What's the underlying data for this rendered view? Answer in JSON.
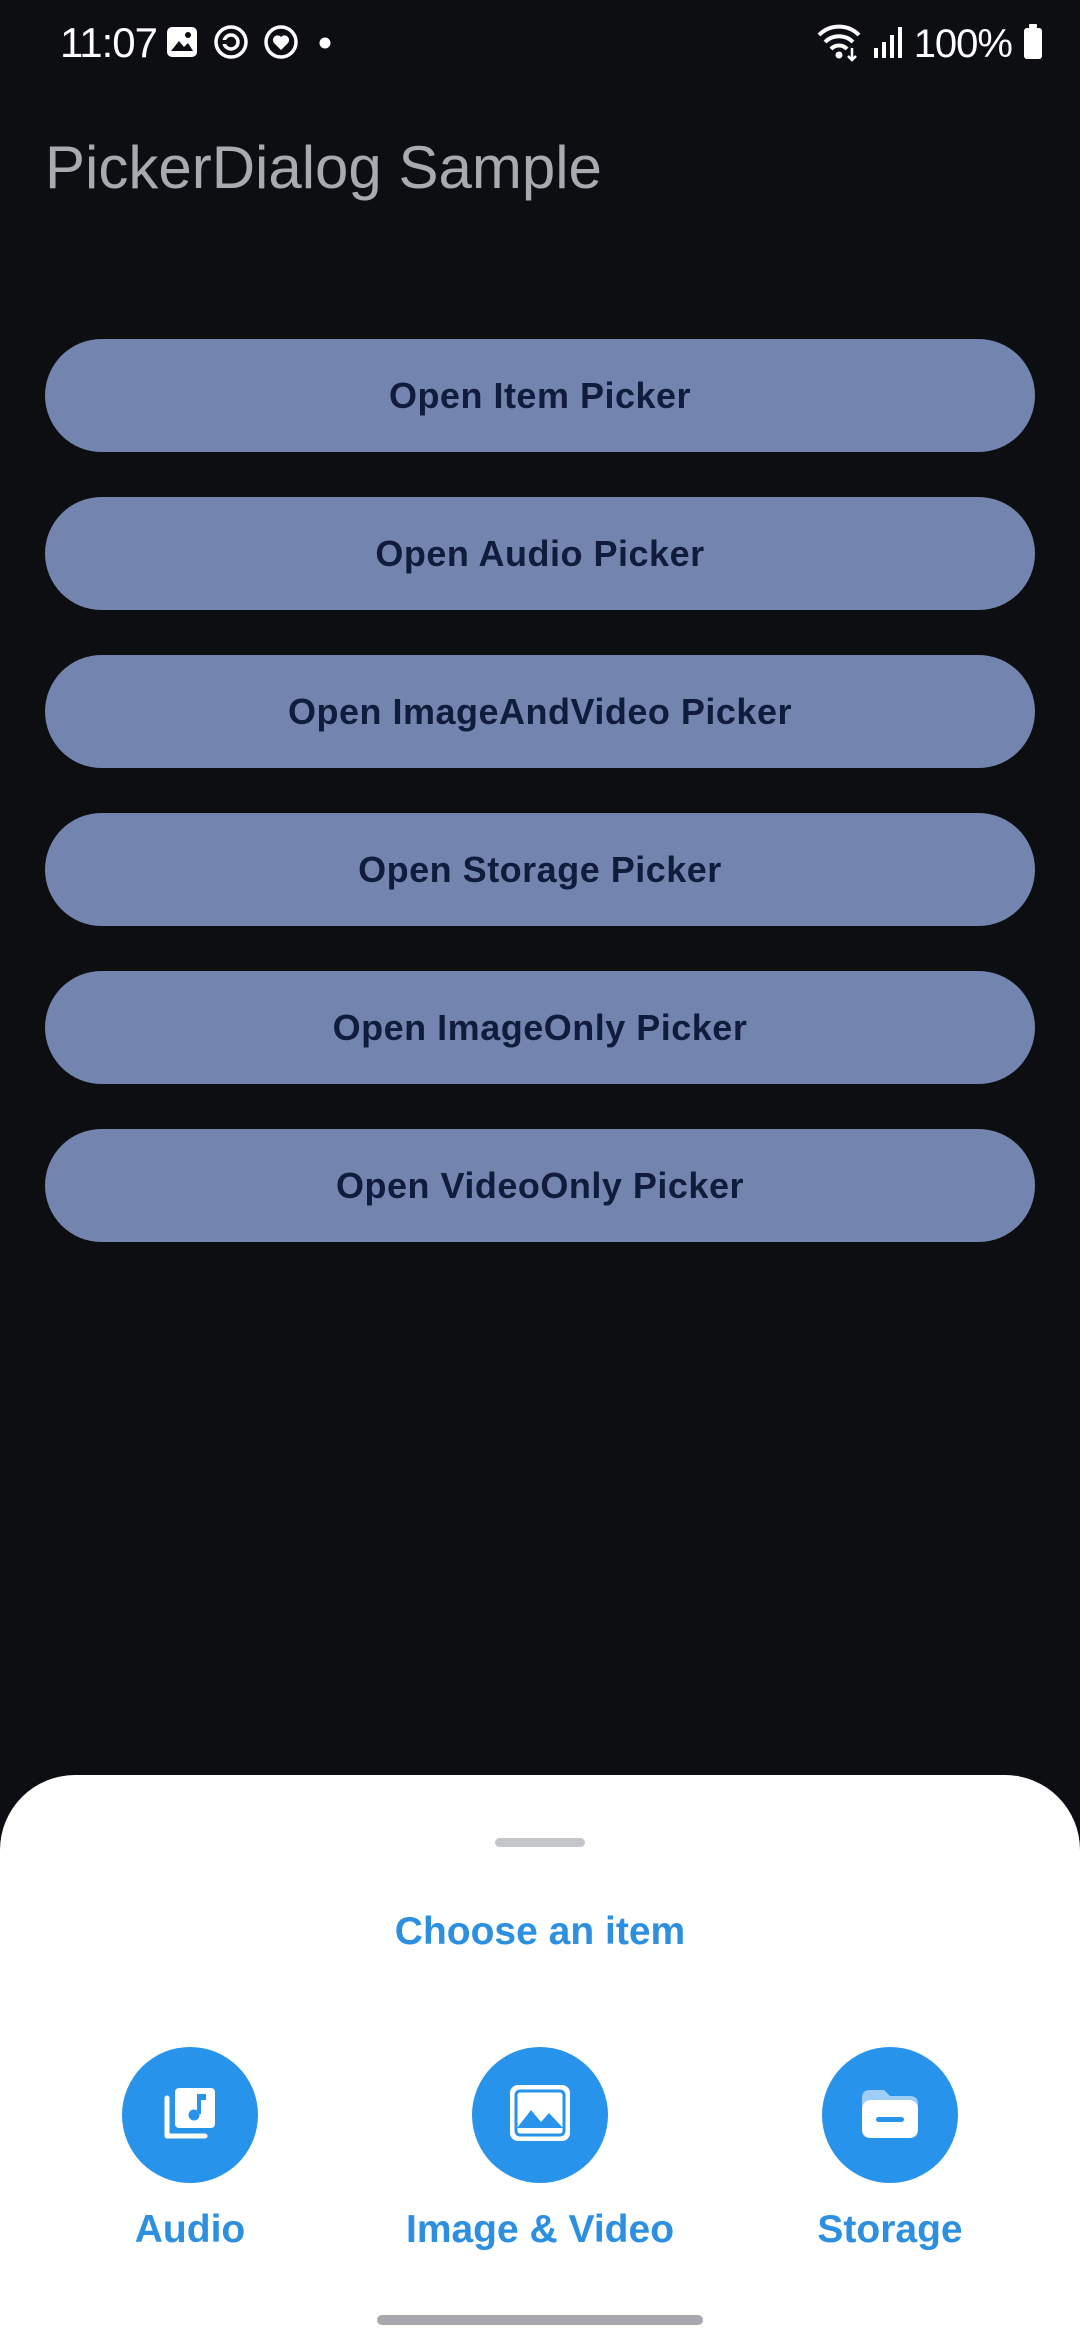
{
  "status_bar": {
    "time": "11:07",
    "battery_text": "100%",
    "icons_left": [
      "gallery-notification-icon",
      "sync-notification-icon",
      "heart-notification-icon",
      "dot-icon"
    ],
    "icons_right": [
      "wifi-icon",
      "signal-icon",
      "battery-icon"
    ]
  },
  "app": {
    "title": "PickerDialog Sample"
  },
  "buttons": [
    {
      "label": "Open Item Picker"
    },
    {
      "label": "Open Audio Picker"
    },
    {
      "label": "Open ImageAndVideo Picker"
    },
    {
      "label": "Open Storage Picker"
    },
    {
      "label": "Open ImageOnly Picker"
    },
    {
      "label": "Open VideoOnly Picker"
    }
  ],
  "sheet": {
    "title": "Choose an item",
    "options": [
      {
        "label": "Audio",
        "icon": "audio-library-icon"
      },
      {
        "label": "Image & Video",
        "icon": "image-icon"
      },
      {
        "label": "Storage",
        "icon": "folder-icon"
      }
    ]
  },
  "colors": {
    "background": "#0d0e11",
    "button": "#7385ae",
    "button_text": "#0f1c3c",
    "accent": "#2893ea",
    "sheet": "#ffffff"
  }
}
